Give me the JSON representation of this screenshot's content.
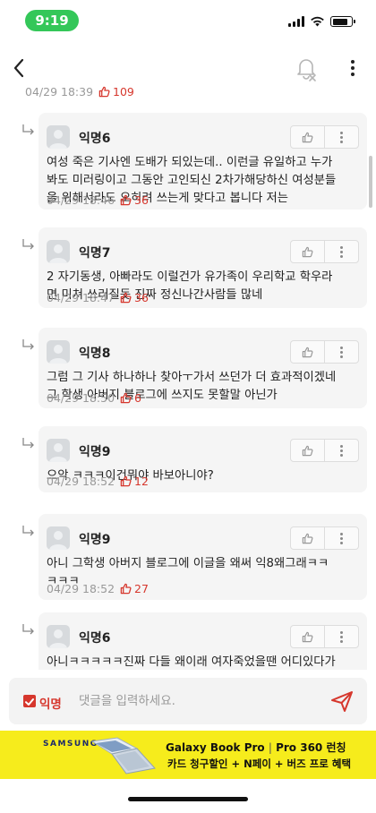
{
  "status_bar": {
    "time": "9:19",
    "battery_level_percent": 80
  },
  "nav": {
    "back_icon": "chevron-left-icon",
    "bell_icon": "bell-off-icon",
    "more_icon": "more-vertical-icon"
  },
  "parent_comment": {
    "timestamp": "04/29 18:39",
    "likes": "109"
  },
  "replies": [
    {
      "author": "익명6",
      "text": "여성 죽은 기사엔 도배가 되있는데.. 이런글 유일하고 누가\n봐도 미러링이고 그동안 고인되신 2차가해당하신 여성분들\n을 위해서라도 오히려 쓰는게 맞다고 봅니다 저는",
      "timestamp": "04/29 18:46",
      "likes": "36"
    },
    {
      "author": "익명7",
      "text": "2 자기동생, 아빠라도 이럴건가 유가족이 우리학교 학우라\n면 미쳐 쓰러질듯 진짜 정신나간사람들 많네",
      "timestamp": "04/29 18:47",
      "likes": "36"
    },
    {
      "author": "익명8",
      "text": "그럼 그 기사 하나하나 찾아ㅜ가서 쓰던가 더 효과적이겠네\n그 학생 아버지 블로그에 쓰지도 못할말 아닌가",
      "timestamp": "04/29 18:50",
      "likes": "6"
    },
    {
      "author": "익명9",
      "text": "으악 ㅋㅋㅋ이건뭐야 바보아니야?",
      "timestamp": "04/29 18:52",
      "likes": "12"
    },
    {
      "author": "익명9",
      "text": "아니 그학생 아버지 블로그에 이글을 왜써 익8왜그래ㅋㅋ\nㅋㅋㅋ",
      "timestamp": "04/29 18:52",
      "likes": "27"
    },
    {
      "author": "익명6",
      "text": "아니ㅋㅋㅋㅋㅋ진짜 다들 왜이래 여자죽었을땐 어디있다가\n이제와서 이러냐고 제발 무시해 그냥.. 속이들이 안 나서도",
      "timestamp": "",
      "likes": ""
    }
  ],
  "comment_input": {
    "anon_label": "익명",
    "placeholder": "댓글을 입력하세요."
  },
  "ad": {
    "brand": "SAMSUNG",
    "title_a": "Galaxy Book Pro",
    "separator": "|",
    "title_b": "Pro 360 런칭",
    "subtitle": "카드 청구할인 + N페이 + 버즈 프로 혜택",
    "accent_color": "#f6ec1c"
  },
  "colors": {
    "accent": "#d6372d",
    "bubble": "#f5f5f5",
    "status_green": "#34c759"
  }
}
